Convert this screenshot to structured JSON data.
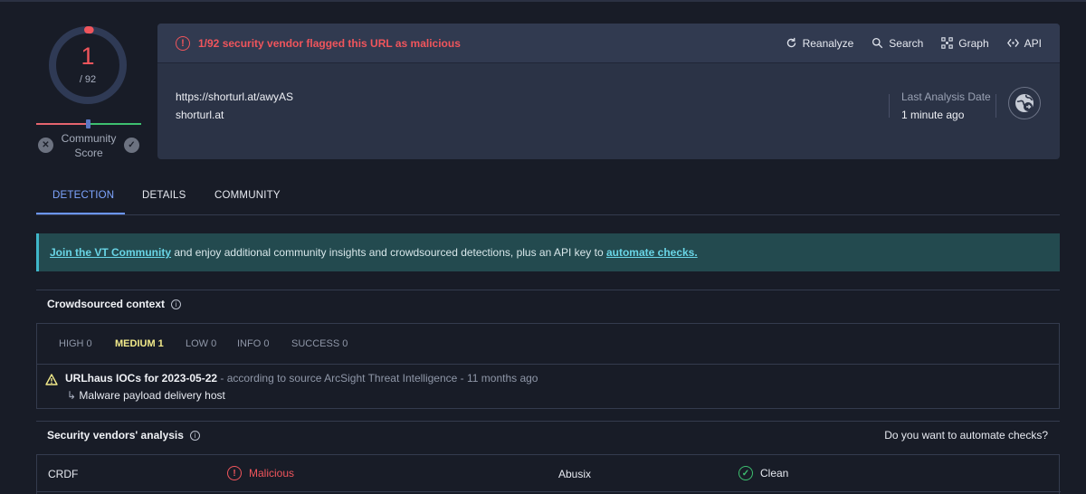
{
  "score": {
    "detections": "1",
    "total": "/ 92",
    "fraction_flagged": 0.0109,
    "community_label": "Community Score",
    "dislike_icon": "x-icon",
    "like_icon": "check-icon"
  },
  "header": {
    "flag_message": "1/92 security vendor flagged this URL as malicious",
    "actions": [
      {
        "label": "Reanalyze",
        "icon": "refresh-icon"
      },
      {
        "label": "Search",
        "icon": "search-icon"
      },
      {
        "label": "Graph",
        "icon": "graph-icon"
      },
      {
        "label": "API",
        "icon": "api-icon"
      }
    ],
    "url": "https://shorturl.at/awyAS",
    "host": "shorturl.at",
    "last_analysis_label": "Last Analysis Date",
    "last_analysis_value": "1 minute ago",
    "globe_icon": "globe-link-icon"
  },
  "tabs": [
    {
      "label": "DETECTION",
      "active": true
    },
    {
      "label": "DETAILS",
      "active": false
    },
    {
      "label": "COMMUNITY",
      "active": false
    }
  ],
  "banner": {
    "link1": "Join the VT Community",
    "middle": " and enjoy additional community insights and crowdsourced detections, plus an API key to ",
    "link2": "automate checks."
  },
  "crowdsourced": {
    "title": "Crowdsourced context",
    "levels": [
      {
        "label": "HIGH 0",
        "active": false
      },
      {
        "label": "MEDIUM 1",
        "active": true
      },
      {
        "label": "LOW 0",
        "active": false
      },
      {
        "label": "INFO 0",
        "active": false
      },
      {
        "label": "SUCCESS 0",
        "active": false
      }
    ],
    "entry": {
      "title": "URLhaus IOCs for 2023-05-22",
      "source": " - according to source ArcSight Threat Intelligence - 11 months ago",
      "detail": "Malware payload delivery host"
    }
  },
  "vendors": {
    "title": "Security vendors' analysis",
    "automate_question": "Do you want to automate checks?",
    "rows": [
      {
        "left_name": "CRDF",
        "left_result": "Malicious",
        "right_name": "Abusix",
        "right_result": "Clean"
      }
    ]
  },
  "colors": {
    "background": "#181c27",
    "malicious": "#f0555c",
    "clean": "#3dbf6f",
    "accent": "#7ea5ff",
    "banner_bg": "#234a4f"
  }
}
